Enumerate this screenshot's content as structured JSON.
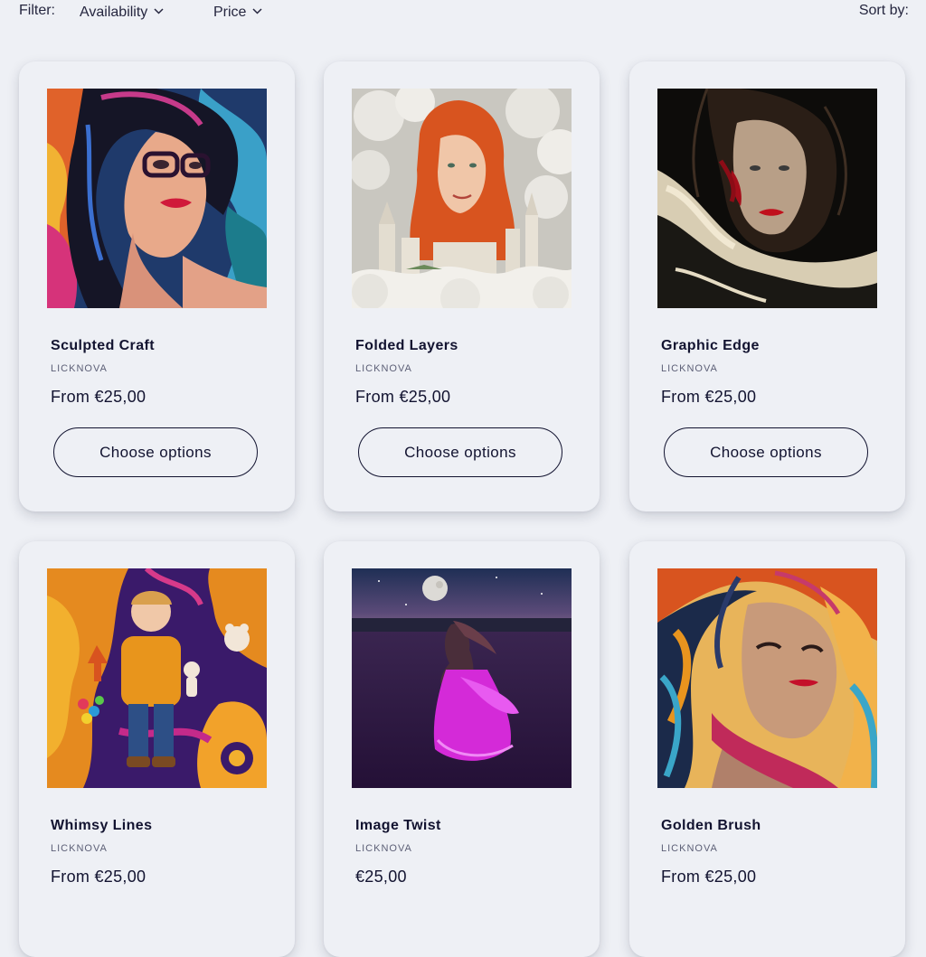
{
  "filter": {
    "label": "Filter:",
    "availability": "Availability",
    "price": "Price",
    "sort_label": "Sort by:"
  },
  "products": [
    {
      "title": "Sculpted Craft",
      "vendor": "LICKNOVA",
      "price": "From €25,00",
      "button": "Choose options"
    },
    {
      "title": "Folded Layers",
      "vendor": "LICKNOVA",
      "price": "From €25,00",
      "button": "Choose options"
    },
    {
      "title": "Graphic Edge",
      "vendor": "LICKNOVA",
      "price": "From €25,00",
      "button": "Choose options"
    },
    {
      "title": "Whimsy Lines",
      "vendor": "LICKNOVA",
      "price": "From €25,00"
    },
    {
      "title": "Image Twist",
      "vendor": "LICKNOVA",
      "price": "€25,00"
    },
    {
      "title": "Golden Brush",
      "vendor": "LICKNOVA",
      "price": "From €25,00"
    }
  ],
  "colors": {
    "background": "#eef0f5",
    "text": "#121330",
    "muted": "#5d6077"
  },
  "icons": {
    "dropdown": "chevron-down-icon"
  }
}
